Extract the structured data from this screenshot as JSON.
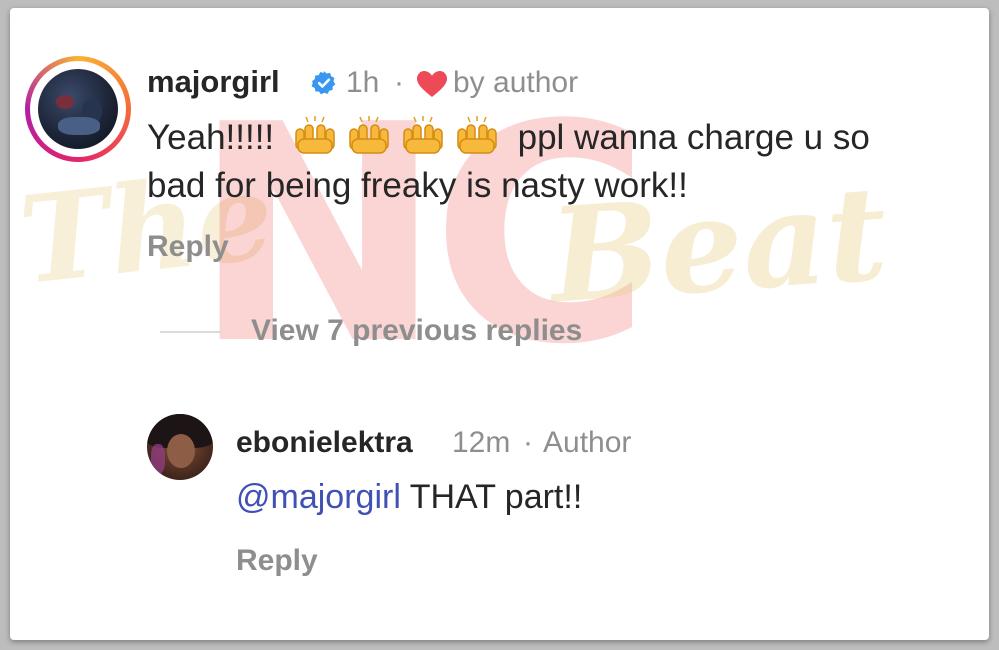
{
  "watermark": {
    "main": "NC",
    "left": "The",
    "right": "Beat"
  },
  "comments": [
    {
      "username": "majorgirl",
      "time": "1h",
      "separator": "·",
      "liked_by": "by author",
      "text_line1_start": "Yeah!!!!!",
      "text_line1_end": "ppl wanna charge u so",
      "text_line2": "bad for being freaky is nasty work!!",
      "reply_label": "Reply",
      "verified": true,
      "heart_color": "#ed4956"
    },
    {
      "username": "ebonielektra",
      "time": "12m",
      "separator": "·",
      "author_badge": "Author",
      "mention": "@majorgirl",
      "text": "THAT part!!",
      "reply_label": "Reply"
    }
  ],
  "view_replies_label": "View 7 previous replies",
  "colors": {
    "verified_blue": "#3897f0",
    "mention_blue": "#3f51b5",
    "text": "#262626",
    "muted": "#8e8e8e"
  },
  "icons": [
    "verified-badge-icon",
    "heart-icon",
    "raising-hands-emoji"
  ]
}
